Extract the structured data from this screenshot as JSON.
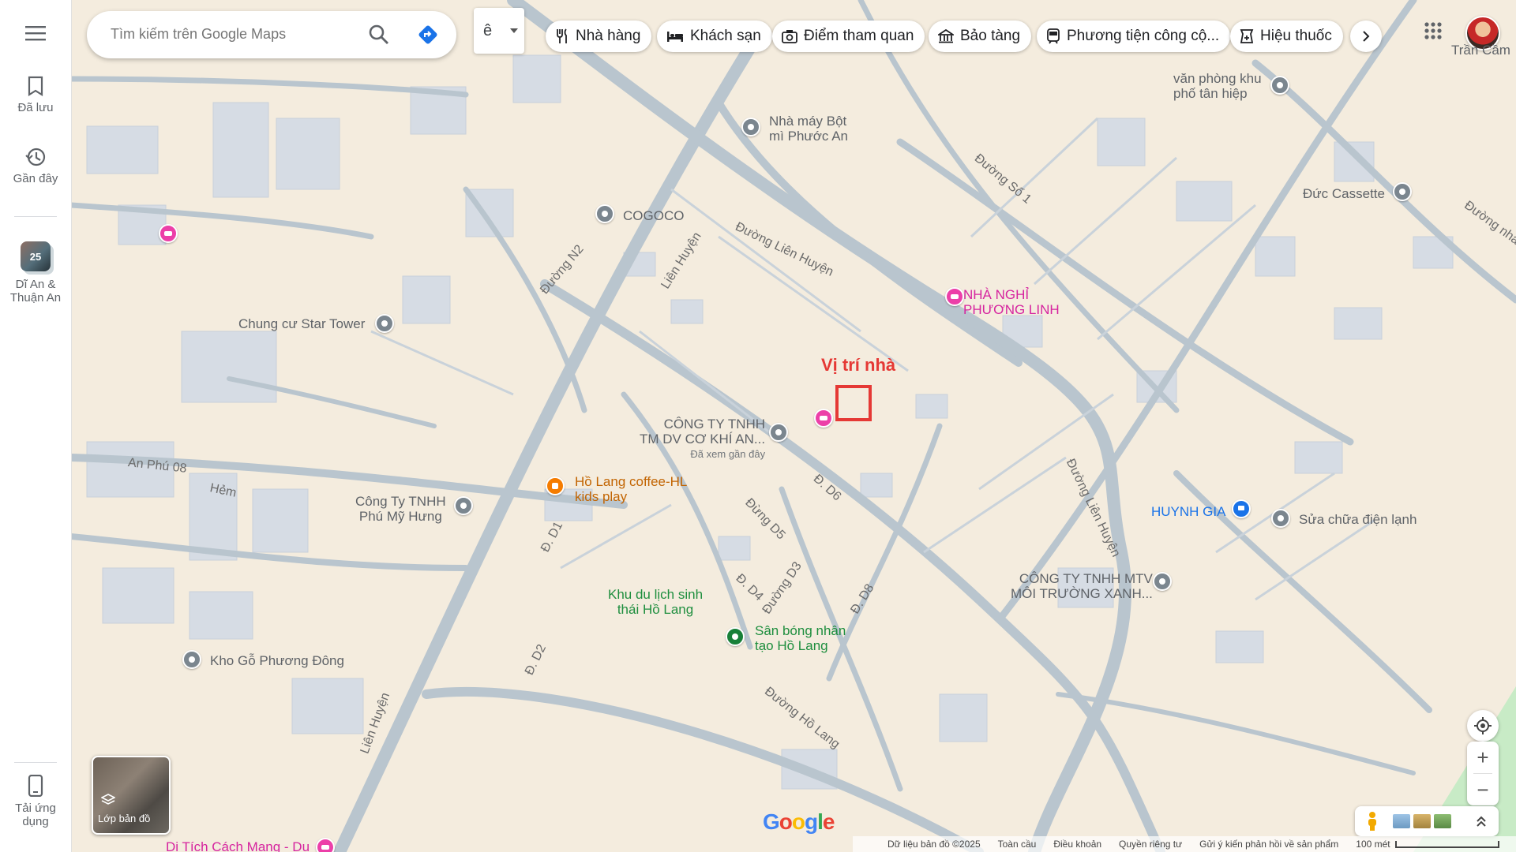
{
  "rail": {
    "menu_icon": "hamburger-menu-icon",
    "saved_label": "Đã lưu",
    "recent_label": "Gần đây",
    "recent_place": {
      "badge": "25",
      "label_line1": "Dĩ An &",
      "label_line2": "Thuận An"
    },
    "download_label_line1": "Tải ứng",
    "download_label_line2": "dụng"
  },
  "search": {
    "placeholder": "Tìm kiếm trên Google Maps"
  },
  "ime": {
    "char": "ê"
  },
  "chips": [
    {
      "label": "Nhà hàng",
      "icon": "fork-knife-icon"
    },
    {
      "label": "Khách sạn",
      "icon": "bed-icon"
    },
    {
      "label": "Điểm tham quan",
      "icon": "camera-icon"
    },
    {
      "label": "Bảo tàng",
      "icon": "museum-icon"
    },
    {
      "label": "Phương tiện công cộ...",
      "icon": "transit-icon"
    },
    {
      "label": "Hiệu thuốc",
      "icon": "pharmacy-icon"
    }
  ],
  "account": {
    "name": "Trần Cầm"
  },
  "marker": {
    "label": "Vị trí nhà",
    "color": "#e53935"
  },
  "places": {
    "van_phong_1": "văn phòng khu",
    "van_phong_2": "phố tân hiệp",
    "nha_may_1": "Nhà máy Bột",
    "nha_may_2": "mì Phước An",
    "cogoco": "COGOCO",
    "duc_cassette": "Đức Cassette",
    "star_tower": "Chung cư Star Tower",
    "nha_nghi_1": "NHÀ NGHỈ",
    "nha_nghi_2": "PHƯƠNG LINH",
    "cong_ty_1": "CÔNG TY TNHH",
    "cong_ty_2": "TM DV CƠ KHÍ AN...",
    "recently_viewed": "Đã xem gần đây",
    "coffee_1": "Hồ Lang coffee-HL",
    "coffee_2": "kids play",
    "phu_my_1": "Công Ty TNHH",
    "phu_my_2": "Phú Mỹ Hưng",
    "huynh_gia": "HUYNH GIA",
    "sua_chua": "Sửa chữa điện lạnh",
    "moi_truong_1": "CÔNG TY TNHH MTV",
    "moi_truong_2": "MÔI TRƯỜNG XANH...",
    "khu_du_lich_1": "Khu du lịch sinh",
    "khu_du_lich_2": "thái Hồ Lang",
    "san_bong_1": "Sân bóng nhân",
    "san_bong_2": "tạo Hồ Lang",
    "kho_go": "Kho Gỗ Phương Đông",
    "di_tich": "Di Tích Cách Mạng - Du"
  },
  "roads": {
    "duong_so_1": "Đường Số 1",
    "duong_nha": "Đường nha",
    "duong_n2": "Đường N2",
    "lien_huyen_a": "Liên Huyện",
    "duong_lien_huyen_a": "Đường Liên Huyện",
    "an_phu_08": "An Phú 08",
    "hem": "Hẻm",
    "d6": "Đ. D6",
    "dung_d5": "Đừng D5",
    "d_d1": "Đ. D1",
    "d_d4": "Đ. D4",
    "duong_d3": "Đường D3",
    "d_d8": "Đ. D8",
    "duong_lien_huyen_b": "Đường Liên Huyện",
    "d_d2": "Đ. D2",
    "duong_ho_lang": "Đường Hồ Lang",
    "lien_huyen_b": "Liên Huyện"
  },
  "layers": {
    "label": "Lớp bản đồ"
  },
  "controls": {
    "zoom_in": "+",
    "zoom_out": "−"
  },
  "logo": "Google",
  "footer": {
    "data": "Dữ liệu bản đồ ©2025",
    "global": "Toàn cầu",
    "terms": "Điều khoản",
    "privacy": "Quyền riêng tư",
    "feedback": "Gửi ý kiến phản hồi về sản phẩm",
    "scale": "100 mét"
  },
  "colors": {
    "land": "#f4ecde",
    "road": "#b7c3cc",
    "building": "#d2d8e0",
    "park": "#c8ebc6"
  }
}
